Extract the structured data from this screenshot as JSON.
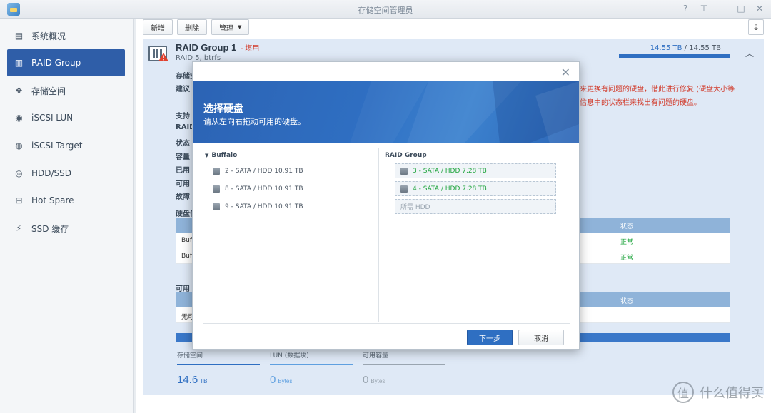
{
  "window": {
    "title": "存储空间管理员"
  },
  "sidebar": {
    "items": [
      {
        "label": "系统概况",
        "icon": "overview-icon"
      },
      {
        "label": "RAID Group",
        "icon": "raid-icon",
        "active": true
      },
      {
        "label": "存储空间",
        "icon": "storage-icon"
      },
      {
        "label": "iSCSI LUN",
        "icon": "lun-icon"
      },
      {
        "label": "iSCSI Target",
        "icon": "target-icon"
      },
      {
        "label": "HDD/SSD",
        "icon": "disk-icon"
      },
      {
        "label": "Hot Spare",
        "icon": "hot-spare-icon"
      },
      {
        "label": "SSD 缓存",
        "icon": "ssd-cache-icon"
      }
    ]
  },
  "toolbar": {
    "create": "新增",
    "delete": "删除",
    "manage": "管理"
  },
  "raid": {
    "title": "RAID Group 1",
    "status": "堪用",
    "subtitle": "RAID 5, btrfs",
    "usage_used": "14.55 TB",
    "usage_sep": " / ",
    "usage_total": "14.55 TB",
    "labels": [
      "存储空",
      "建议",
      "支持",
      "RAID",
      "状态",
      "容量",
      "已用",
      "可用",
      "故障"
    ],
    "warning_line1": "来更换有问题的硬盘，借此进行修复 (硬盘大小等",
    "warning_line2": "信息中的状态栏来找出有问题的硬盘。",
    "disk_section": "硬盘信",
    "table1": {
      "state_header": "状态",
      "rows": [
        {
          "name": "Buf",
          "state": "正常"
        },
        {
          "name": "Buf",
          "state": "正常"
        }
      ]
    },
    "avail_section": "可用",
    "table2": {
      "state_header": "状态",
      "rows": [
        {
          "name": "无可"
        }
      ]
    },
    "stats": [
      {
        "label": "存储空间",
        "value": "14.6",
        "unit": "TB",
        "color": "#2f6fc2"
      },
      {
        "label": "LUN (数据块)",
        "value": "0",
        "unit": "Bytes",
        "color": "#5fa0e0"
      },
      {
        "label": "可用容量",
        "value": "0",
        "unit": "Bytes",
        "color": "#9aa5b0"
      }
    ]
  },
  "modal": {
    "title": "选择硬盘",
    "subtitle": "请从左向右拖动可用的硬盘。",
    "source_group": "Buffalo",
    "source_disks": [
      "2 - SATA / HDD 10.91 TB",
      "8 - SATA / HDD 10.91 TB",
      "9 - SATA / HDD 10.91 TB"
    ],
    "target_group": "RAID Group",
    "target_disks": [
      "3 - SATA / HDD 7.28 TB",
      "4 - SATA / HDD 7.28 TB"
    ],
    "target_placeholder": "所需 HDD",
    "next_button": "下一步",
    "cancel_button": "取消"
  },
  "watermark": {
    "text": "什么值得买",
    "symbol": "值"
  }
}
